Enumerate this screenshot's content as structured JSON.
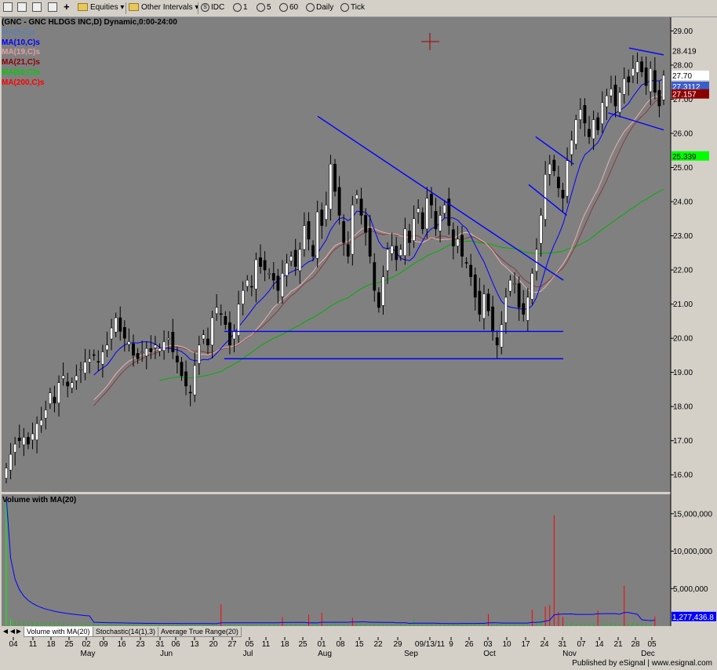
{
  "toolbar": {
    "equities_label": "Equities",
    "intervals_label": "Other Intervals",
    "symbol": "IDC",
    "interval_1": "1",
    "interval_5": "5",
    "interval_60": "60",
    "daily": "Daily",
    "tick": "Tick"
  },
  "legend": {
    "title": "(GNC - GNC HLDGS INC,D) Dynamic,0:00-24:00",
    "items": [
      "MA(8,C)s",
      "MA(10,C)s",
      "MA(19,C)s",
      "MA(21,C)s",
      "MA(50,C)s",
      "MA(200,C)s"
    ],
    "colors": [
      "#5a7fb8",
      "#0000ff",
      "#e0a0a0",
      "#8b0000",
      "#00cc00",
      "#ff0000"
    ]
  },
  "volume_panel_label": "Volume with MA(20)",
  "tabs": [
    "Volume with MA(20)",
    "Stochastic(14(1),3)",
    "Average True Range(20)"
  ],
  "footer": "Published by eSignal | www.esignal.com",
  "price_badges": {
    "last": "27.70",
    "ma_fast": "27.3112",
    "ma_mid": "27.157",
    "ma50": "25.339",
    "high": "28.419",
    "volume": "1,277,436.8"
  },
  "chart_data": [
    {
      "type": "candlestick",
      "title": "(GNC - GNC HLDGS INC,D) Dynamic,0:00-24:00",
      "ylim": [
        15.5,
        29.4
      ],
      "y_ticks": [
        "29.00",
        "28.00",
        "27.00",
        "26.00",
        "25.00",
        "24.00",
        "23.00",
        "22.00",
        "21.00",
        "20.00",
        "19.00",
        "18.00",
        "17.00",
        "16.00"
      ],
      "x_ticks": [
        "04",
        "11",
        "18",
        "25",
        "02",
        "09",
        "16",
        "23",
        "31",
        "06",
        "13",
        "20",
        "27",
        "05",
        "11",
        "18",
        "25",
        "01",
        "08",
        "15",
        "22",
        "29",
        "09/13/11",
        "9",
        "26",
        "03",
        "10",
        "17",
        "24",
        "31",
        "07",
        "14",
        "21",
        "28",
        "05"
      ],
      "month_labels": [
        "May",
        "Jun",
        "Jul",
        "Aug",
        "Sep",
        "Oct",
        "Nov",
        "Dec"
      ],
      "closes": [
        16.2,
        16.6,
        16.9,
        17.0,
        17.1,
        16.9,
        17.2,
        17.5,
        17.6,
        17.9,
        18.4,
        18.1,
        18.7,
        18.9,
        18.6,
        18.7,
        18.9,
        19.1,
        19.3,
        19.4,
        19.5,
        19.3,
        19.6,
        19.8,
        20.3,
        20.6,
        20.2,
        20.0,
        19.9,
        19.5,
        19.4,
        19.6,
        19.7,
        19.6,
        19.8,
        19.7,
        19.9,
        20.0,
        19.6,
        19.3,
        18.9,
        18.6,
        18.4,
        19.2,
        19.8,
        20.1,
        19.8,
        20.6,
        20.9,
        20.7,
        20.4,
        19.8,
        20.2,
        21.0,
        21.4,
        21.7,
        21.5,
        22.3,
        22.1,
        22.0,
        21.9,
        21.7,
        21.4,
        21.9,
        22.2,
        22.4,
        22.1,
        22.6,
        23.3,
        22.9,
        22.4,
        23.7,
        23.3,
        23.9,
        25.1,
        24.3,
        23.6,
        22.8,
        22.4,
        23.9,
        24.2,
        23.6,
        23.1,
        22.4,
        21.4,
        20.9,
        21.8,
        22.6,
        22.7,
        22.3,
        22.6,
        23.2,
        22.8,
        23.5,
        23.8,
        23.2,
        24.1,
        23.9,
        23.2,
        23.6,
        23.9,
        23.3,
        22.7,
        22.9,
        22.4,
        22.2,
        21.8,
        21.2,
        20.7,
        21.3,
        20.8,
        20.2,
        19.8,
        20.4,
        21.2,
        21.7,
        21.6,
        20.9,
        20.7,
        21.2,
        21.9,
        22.6,
        23.6,
        24.8,
        25.1,
        24.9,
        24.4,
        24.1,
        25.2,
        25.8,
        26.4,
        26.7,
        26.3,
        25.9,
        26.4,
        26.1,
        26.9,
        27.1,
        27.3,
        26.8,
        27.2,
        27.6,
        27.5,
        27.9,
        28.1,
        27.8,
        27.4,
        27.9,
        27.2,
        26.8,
        27.7
      ],
      "lines_drawn": [
        "descending trendline",
        "support line ~20.2",
        "support line ~19.4",
        "flag channel",
        "wedge channel"
      ]
    },
    {
      "type": "bar",
      "title": "Volume with MA(20)",
      "y_ticks": [
        "15,000,000",
        "10,000,000",
        "5,000,000"
      ],
      "ylim": [
        0,
        17600000
      ],
      "volumes": [
        17200000,
        900000,
        700000,
        600000,
        650000,
        600000,
        550000,
        500000,
        550000,
        500000,
        600000,
        450000,
        500000,
        450000,
        400000,
        450000,
        400000,
        380000,
        360000,
        420000,
        380000,
        400000,
        350000,
        380000,
        400000,
        360000,
        340000,
        360000,
        320000,
        300000,
        330000,
        350000,
        300000,
        320000,
        380000,
        350000,
        400000,
        300000,
        320000,
        380000,
        340000,
        300000,
        280000,
        320000,
        350000,
        340000,
        280000,
        260000,
        300000,
        2900000,
        320000,
        350000,
        300000,
        280000,
        320000,
        300000,
        280000,
        350000,
        320000,
        300000,
        350000,
        280000,
        320000,
        1200000,
        380000,
        420000,
        400000,
        350000,
        300000,
        1500000,
        400000,
        320000,
        1800000,
        350000,
        300000,
        400000,
        320000,
        280000,
        350000,
        1100000,
        420000,
        380000,
        300000,
        280000,
        320000,
        350000,
        300000,
        350000,
        280000,
        320000,
        300000,
        260000,
        320000,
        900000,
        300000,
        350000,
        400000,
        320000,
        380000,
        300000,
        350000,
        280000,
        320000,
        300000,
        350000,
        380000,
        420000,
        320000,
        380000,
        400000,
        1600000,
        380000,
        320000,
        350000,
        300000,
        280000,
        400000,
        300000,
        420000,
        380000,
        2200000,
        350000,
        900000,
        2600000,
        2800000,
        14800000,
        1900000,
        1200000,
        400000,
        500000,
        380000,
        420000,
        380000,
        350000,
        400000,
        2100000,
        420000,
        380000,
        400000,
        420000,
        350000,
        5400000,
        380000,
        450000,
        400000,
        420000,
        380000,
        350000,
        1277436
      ]
    }
  ]
}
